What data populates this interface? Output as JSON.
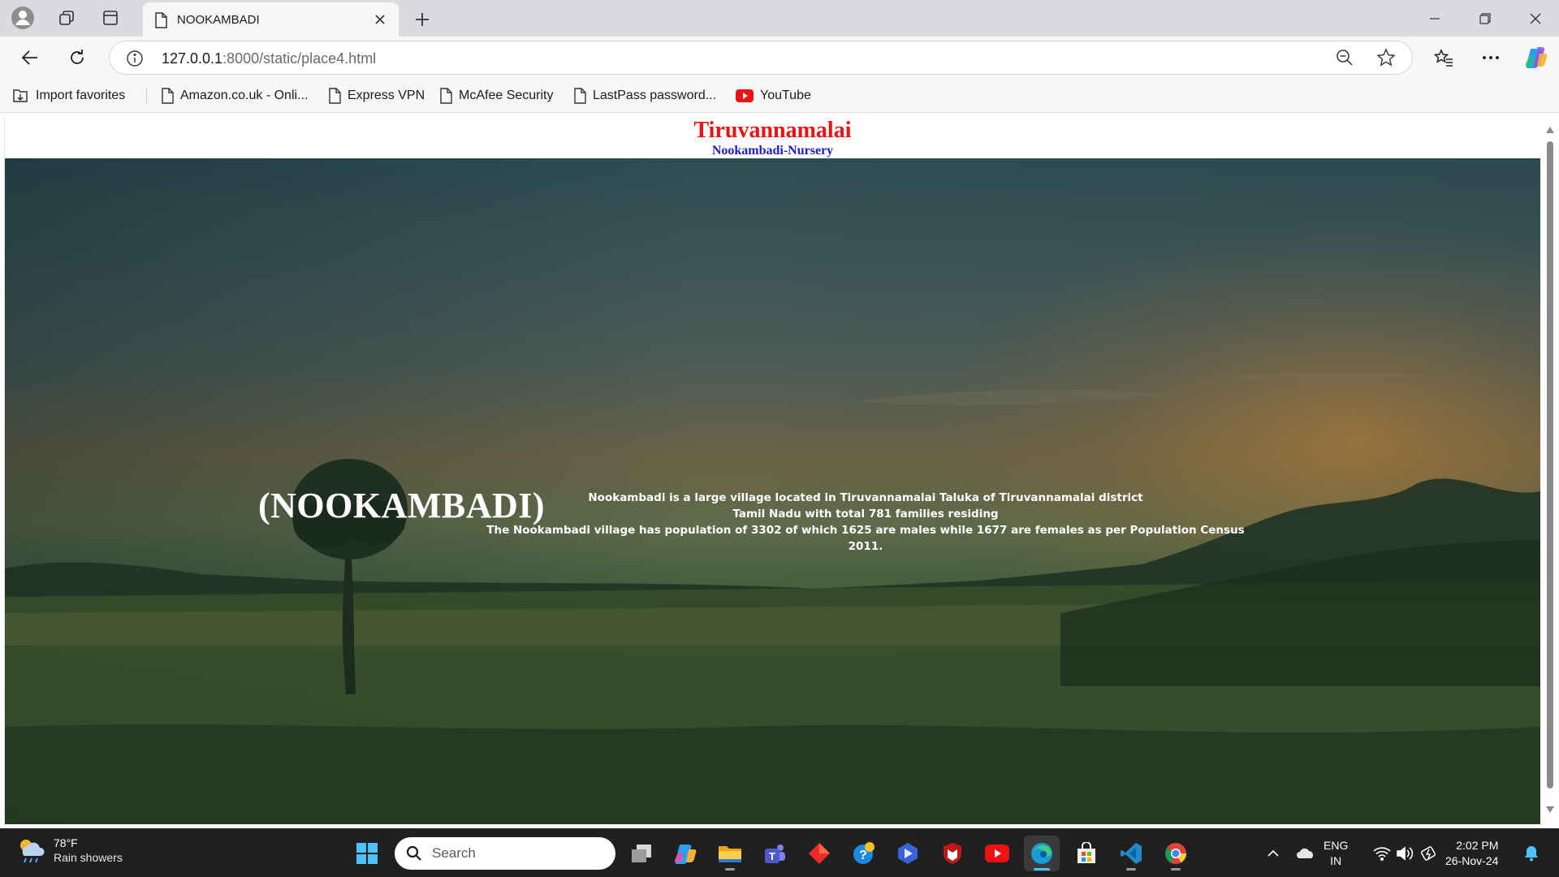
{
  "browser": {
    "tab": {
      "title": "NOOKAMBADI"
    },
    "address": {
      "host": "127.0.0.1",
      "rest": ":8000/static/place4.html"
    },
    "favorites": [
      {
        "label": "Import favorites"
      },
      {
        "label": "Amazon.co.uk - Onli..."
      },
      {
        "label": "Express VPN"
      },
      {
        "label": "McAfee Security"
      },
      {
        "label": "LastPass password..."
      },
      {
        "label": "YouTube"
      }
    ]
  },
  "page": {
    "title": "Tiruvannamalai",
    "subtitle": "Nookambadi-Nursery",
    "hero": {
      "heading": "(NOOKAMBADI)",
      "line1": "Nookambadi is a large village located in Tiruvannamalai Taluka of Tiruvannamalai district",
      "line2": "Tamil Nadu with total 781 families residing",
      "line3": "The Nookambadi village has population of 3302 of which 1625 are males while 1677 are females as per Population Census 2011."
    }
  },
  "taskbar": {
    "weather": {
      "temp": "78°F",
      "desc": "Rain showers"
    },
    "search_label": "Search",
    "lang_line1": "ENG",
    "lang_line2": "IN",
    "time": "2:02 PM",
    "date": "26-Nov-24"
  }
}
